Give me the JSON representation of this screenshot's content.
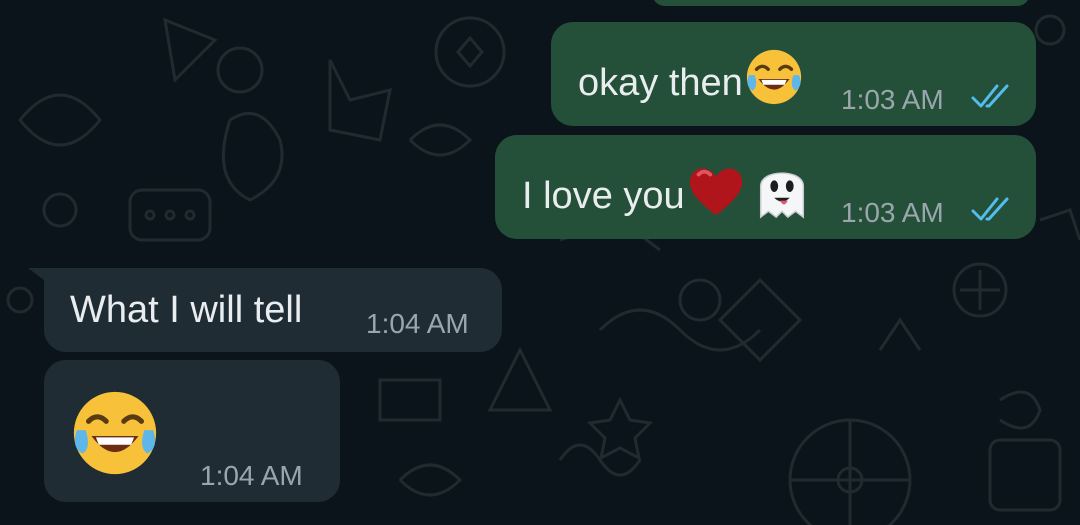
{
  "messages": [
    {
      "id": "m1",
      "direction": "outgoing",
      "text": "okay then",
      "emoji": [
        "face-with-tears-of-joy"
      ],
      "time": "1:03 AM",
      "status": "read"
    },
    {
      "id": "m2",
      "direction": "outgoing",
      "text": "I love you",
      "emoji": [
        "red-heart",
        "ghost"
      ],
      "time": "1:03 AM",
      "status": "read"
    },
    {
      "id": "m3",
      "direction": "incoming",
      "text": "What I will tell",
      "emoji": [],
      "time": "1:04 AM"
    },
    {
      "id": "m4",
      "direction": "incoming",
      "text": "",
      "emoji": [
        "face-with-tears-of-joy"
      ],
      "time": "1:04 AM"
    }
  ],
  "colors": {
    "background": "#0b141a",
    "outgoing_bubble": "#24503a",
    "incoming_bubble": "#1f2c34",
    "text": "#e9edef",
    "timestamp": "#9aa6ac",
    "read_ticks": "#53bdeb"
  }
}
